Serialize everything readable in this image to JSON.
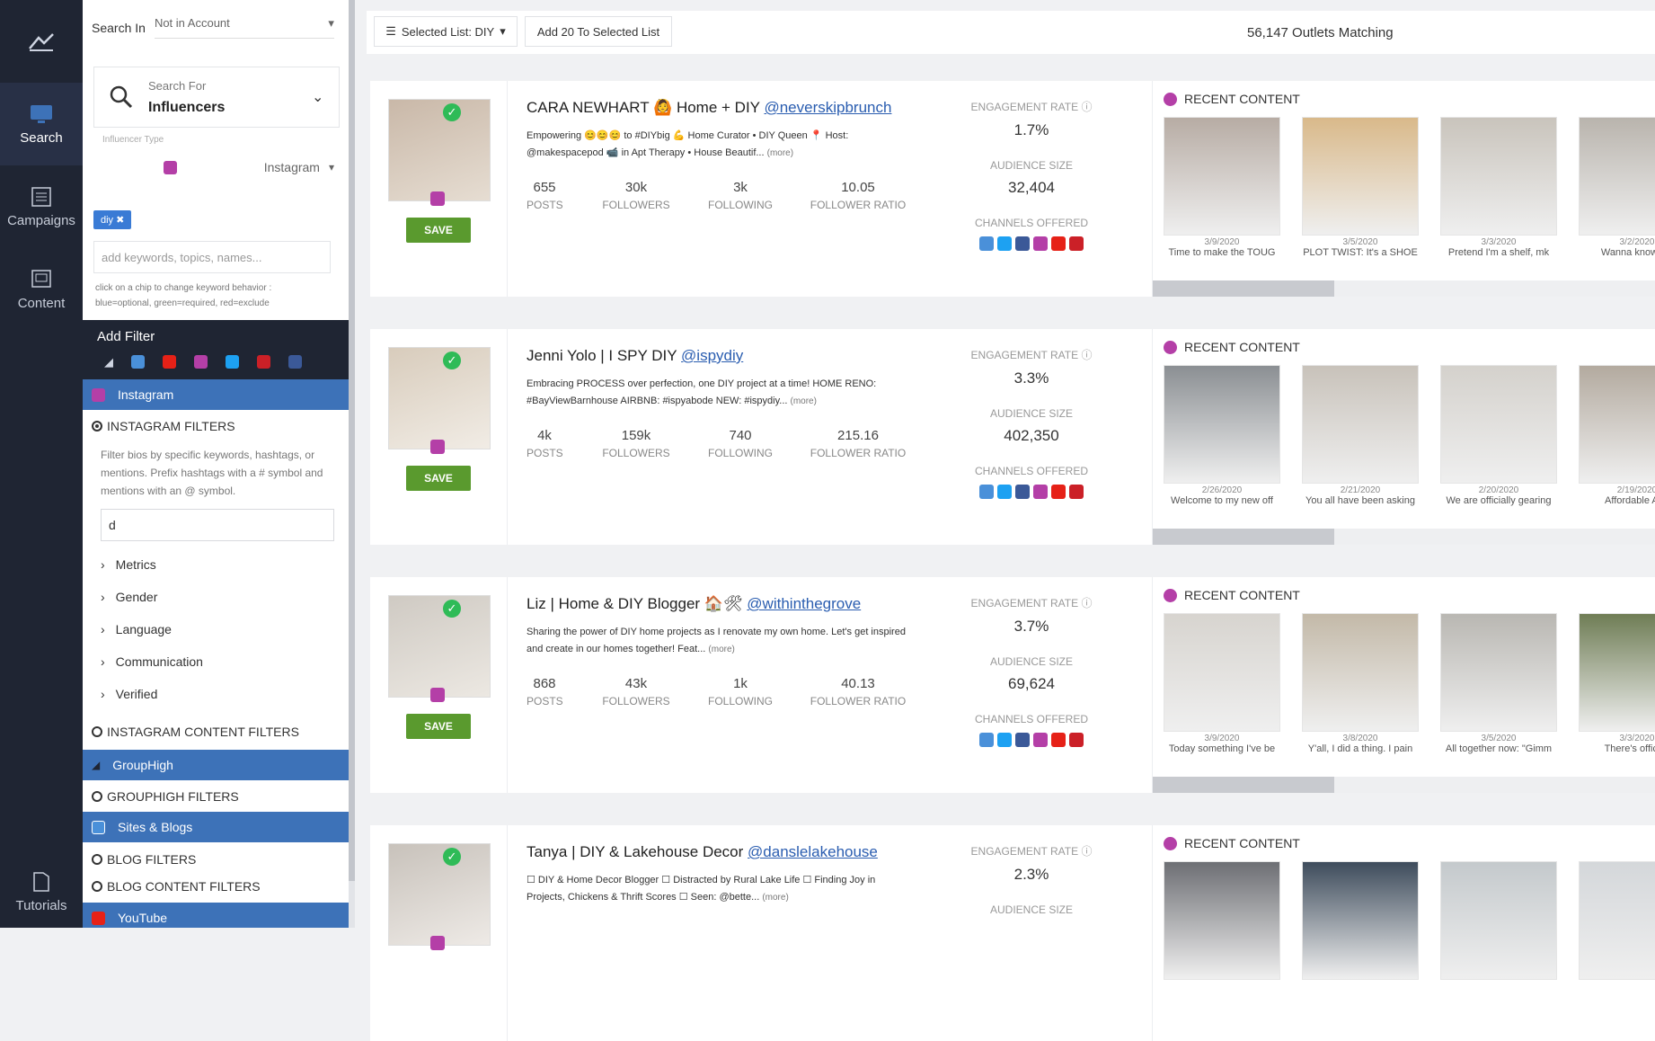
{
  "rail": {
    "items": [
      {
        "label": "Search",
        "icon": "monitor-icon"
      },
      {
        "label": "Campaigns",
        "icon": "list-icon"
      },
      {
        "label": "Content",
        "icon": "content-icon"
      }
    ],
    "tutorials": "Tutorials"
  },
  "panel": {
    "search_in_label": "Search In",
    "search_in_value": "Not in Account",
    "search_for_label": "Search For",
    "search_for_value": "Influencers",
    "influencer_type_label": "Influencer Type",
    "influencer_type_value": "Instagram",
    "chip": "diy",
    "keyword_placeholder": "add keywords, topics, names...",
    "keyword_hint": "click on a chip to change keyword behavior : blue=optional, green=required, red=exclude",
    "add_filter": "Add Filter",
    "instagram_bar": "Instagram",
    "instagram_filters": "INSTAGRAM FILTERS",
    "instagram_desc": "Filter bios by specific keywords, hashtags, or mentions. Prefix hashtags with a # symbol and mentions with an @ symbol.",
    "instagram_input_value": "d",
    "collapsibles": [
      "Metrics",
      "Gender",
      "Language",
      "Communication",
      "Verified"
    ],
    "instagram_content_filters": "INSTAGRAM CONTENT FILTERS",
    "grouphigh_bar": "GroupHigh",
    "grouphigh_filters": "GROUPHIGH FILTERS",
    "sites_bar": "Sites & Blogs",
    "blog_filters": "BLOG FILTERS",
    "blog_content_filters": "BLOG CONTENT FILTERS",
    "youtube_bar": "YouTube"
  },
  "topbar": {
    "selected_list": "Selected List: DIY",
    "add_button": "Add 20 To Selected List",
    "matching": "56,147 Outlets Matching"
  },
  "labels": {
    "save": "SAVE",
    "engagement": "ENGAGEMENT RATE",
    "audience": "AUDIENCE SIZE",
    "channels": "CHANNELS OFFERED",
    "recent": "RECENT CONTENT",
    "posts": "POSTS",
    "followers": "FOLLOWERS",
    "following": "FOLLOWING",
    "ratio": "FOLLOWER RATIO",
    "more": "(more)"
  },
  "colors": {
    "blog": "#4a90d9",
    "twitter": "#1da1f2",
    "facebook": "#3b5998",
    "instagram": "#b43fa7",
    "youtube": "#e62117",
    "pinterest": "#cb2027"
  },
  "influencers": [
    {
      "name": "CARA NEWHART 🙆 Home + DIY",
      "handle": "@neverskipbrunch",
      "bio": "Empowering 😊😊😊 to #DIYbig 💪 Home Curator • DIY Queen 📍 Host: @makespacepod 📹 in Apt Therapy • House Beautif...",
      "posts": "655",
      "followers": "30k",
      "following": "3k",
      "ratio": "10.05",
      "engagement": "1.7%",
      "audience": "32,404",
      "recent": [
        {
          "date": "3/9/2020",
          "caption": "Time to make the TOUG"
        },
        {
          "date": "3/5/2020",
          "caption": "PLOT TWIST: It's a SHOE"
        },
        {
          "date": "3/3/2020",
          "caption": "Pretend I'm a shelf, mk"
        },
        {
          "date": "3/2/2020",
          "caption": "Wanna know wh"
        }
      ]
    },
    {
      "name": "Jenni Yolo | I SPY DIY",
      "handle": "@ispydiy",
      "bio": "Embracing PROCESS over perfection, one DIY project at a time! HOME RENO: #BayViewBarnhouse AIRBNB: #ispyabode NEW: #ispydiy...",
      "posts": "4k",
      "followers": "159k",
      "following": "740",
      "ratio": "215.16",
      "engagement": "3.3%",
      "audience": "402,350",
      "recent": [
        {
          "date": "2/26/2020",
          "caption": "Welcome to my new off"
        },
        {
          "date": "2/21/2020",
          "caption": "You all have been asking"
        },
        {
          "date": "2/20/2020",
          "caption": "We are officially gearing"
        },
        {
          "date": "2/19/2020",
          "caption": "Affordable Airb"
        }
      ]
    },
    {
      "name": "Liz | Home & DIY Blogger 🏠🛠",
      "handle": "@withinthegrove",
      "bio": "Sharing the power of DIY home projects as I renovate my own home. Let's get inspired and create in our homes together! Feat...",
      "posts": "868",
      "followers": "43k",
      "following": "1k",
      "ratio": "40.13",
      "engagement": "3.7%",
      "audience": "69,624",
      "recent": [
        {
          "date": "3/9/2020",
          "caption": "Today something I've be"
        },
        {
          "date": "3/8/2020",
          "caption": "Y'all, I did a thing. I pain"
        },
        {
          "date": "3/5/2020",
          "caption": "All together now: \"Gimm"
        },
        {
          "date": "3/3/2020",
          "caption": "There's officiall"
        }
      ]
    },
    {
      "name": "Tanya | DIY & Lakehouse Decor",
      "handle": "@danslelakehouse",
      "bio": "☐ DIY & Home Decor Blogger ☐ Distracted by Rural Lake Life ☐ Finding Joy in Projects, Chickens & Thrift Scores ☐ Seen: @bette...",
      "engagement": "2.3%",
      "audience_label_partial": "AUDIENCE SIZE"
    }
  ]
}
